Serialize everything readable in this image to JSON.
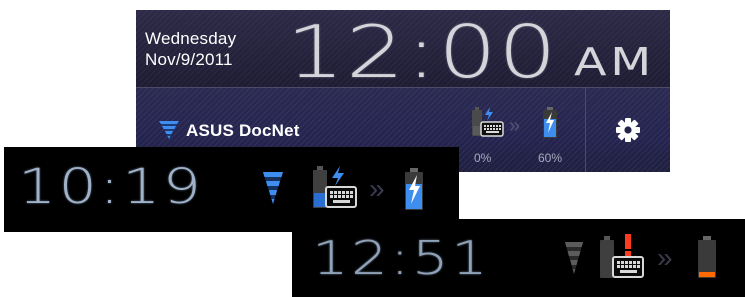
{
  "panel": {
    "date": {
      "weekday": "Wednesday",
      "date": "Nov/9/2011"
    },
    "clock": {
      "time": "12:00",
      "ampm": "AM"
    },
    "wifi": {
      "network_name": "ASUS DocNet",
      "icon": "wifi-signal-icon"
    },
    "dock_battery": {
      "icon": "dock-keyboard-battery-charging-icon",
      "percent": "0%"
    },
    "arrows": "»",
    "tablet_battery": {
      "icon": "tablet-battery-charging-icon",
      "percent": "60%"
    },
    "settings": {
      "icon": "gear-icon"
    },
    "colors": {
      "accent_blue": "#3e8ef0",
      "panel_bg": "#24244a",
      "clock_text": "#d4d4da"
    }
  },
  "status_bar_1": {
    "time": "10:19",
    "icons": [
      "wifi-signal-icon",
      "dock-keyboard-battery-charging-icon",
      "charge-arrows-icon",
      "tablet-battery-charging-icon"
    ],
    "arrows": "»"
  },
  "status_bar_2": {
    "time": "12:51",
    "icons": [
      "wifi-signal-icon",
      "dock-keyboard-battery-alert-icon",
      "charge-arrows-icon",
      "tablet-battery-low-icon"
    ],
    "arrows": "»",
    "colors": {
      "alert": "#ff3b1f",
      "low_battery": "#ff6a00"
    }
  }
}
